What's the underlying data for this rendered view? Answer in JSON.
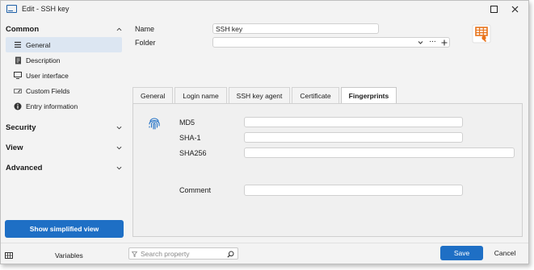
{
  "window": {
    "title": "Edit - SSH key"
  },
  "sidebar": {
    "sections": [
      {
        "label": "Common",
        "expanded": true
      },
      {
        "label": "Security",
        "expanded": false
      },
      {
        "label": "View",
        "expanded": false
      },
      {
        "label": "Advanced",
        "expanded": false
      }
    ],
    "common_items": [
      {
        "label": "General",
        "icon": "list-icon",
        "active": true
      },
      {
        "label": "Description",
        "icon": "note-icon",
        "active": false
      },
      {
        "label": "User interface",
        "icon": "monitor-icon",
        "active": false
      },
      {
        "label": "Custom Fields",
        "icon": "edit-field-icon",
        "active": false
      },
      {
        "label": "Entry information",
        "icon": "info-icon",
        "active": false
      }
    ],
    "simplified_button": "Show simplified view"
  },
  "form": {
    "name_label": "Name",
    "name_value": "SSH key",
    "folder_label": "Folder",
    "folder_value": ""
  },
  "tabs": [
    {
      "label": "General",
      "active": false
    },
    {
      "label": "Login name",
      "active": false
    },
    {
      "label": "SSH key agent",
      "active": false
    },
    {
      "label": "Certificate",
      "active": false
    },
    {
      "label": "Fingerprints",
      "active": true
    }
  ],
  "fingerprints": {
    "md5_label": "MD5",
    "md5_value": "",
    "sha1_label": "SHA-1",
    "sha1_value": "",
    "sha256_label": "SHA256",
    "sha256_value": "",
    "comment_label": "Comment",
    "comment_value": ""
  },
  "bottom": {
    "variables_label": "Variables",
    "search_placeholder": "Search property",
    "save_label": "Save",
    "cancel_label": "Cancel"
  },
  "colors": {
    "accent": "#1e6fc5",
    "entry_icon": "#e8731a",
    "fingerprint_icon": "#1e6fc5"
  }
}
